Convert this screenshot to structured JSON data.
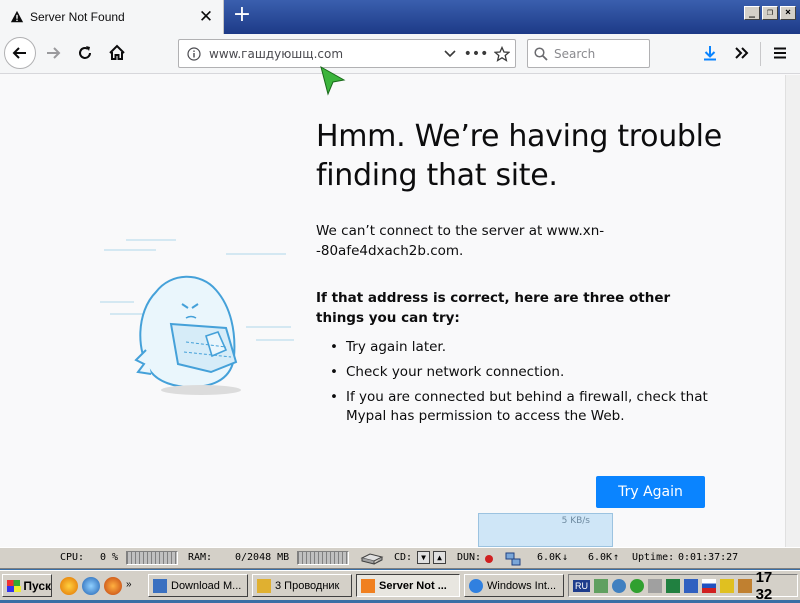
{
  "browser": {
    "tab_title": "Server Not Found",
    "url": "www.гашдуюшщ.com",
    "search_placeholder": "Search",
    "more_actions": "•••"
  },
  "page": {
    "heading": "Hmm. We’re having trouble finding that site.",
    "message": "We can’t connect to the server at www.xn--80afe4dxach2b.com.",
    "suggestions_title": "If that address is correct, here are three other things you can try:",
    "suggestions": [
      "Try again later.",
      "Check your network connection.",
      "If you are connected but behind a firewall, check that Mypal has permission to access the Web."
    ],
    "try_again_label": "Try Again"
  },
  "net_widget": {
    "rate": "5 KB/s"
  },
  "monitor": {
    "cpu_label": "CPU:",
    "cpu_value": "0 %",
    "ram_label": "RAM:",
    "ram_value": "0/2048 MB",
    "cd_label": "CD:",
    "dun_label": "DUN:",
    "rx": "6.0K",
    "tx": "6.0K",
    "uptime_label": "Uptime:",
    "uptime_value": "0:01:37:27"
  },
  "taskbar": {
    "start_label": "Пуск",
    "tasks": [
      {
        "label": "Download M..."
      },
      {
        "label": "3 Проводник"
      },
      {
        "label": "Server Not ..."
      },
      {
        "label": "Windows Int..."
      }
    ],
    "lang": "RU",
    "clock": "17 32"
  },
  "colors": {
    "accent": "#0a84ff",
    "title_bar": "#1d3a87",
    "taskbar": "#d4d0c8"
  }
}
